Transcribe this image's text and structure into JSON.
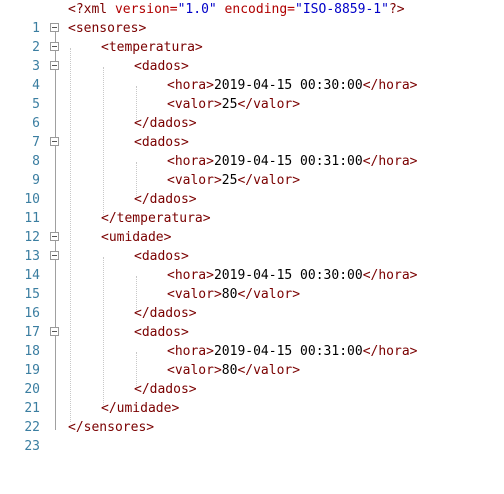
{
  "editor": {
    "lines": [
      {
        "n": "1"
      },
      {
        "n": "2"
      },
      {
        "n": "3"
      },
      {
        "n": "4"
      },
      {
        "n": "5"
      },
      {
        "n": "6"
      },
      {
        "n": "7"
      },
      {
        "n": "8"
      },
      {
        "n": "9"
      },
      {
        "n": "10"
      },
      {
        "n": "11"
      },
      {
        "n": "12"
      },
      {
        "n": "13"
      },
      {
        "n": "14"
      },
      {
        "n": "15"
      },
      {
        "n": "16"
      },
      {
        "n": "17"
      },
      {
        "n": "18"
      },
      {
        "n": "19"
      },
      {
        "n": "20"
      },
      {
        "n": "21"
      },
      {
        "n": "22"
      },
      {
        "n": "23"
      }
    ],
    "tokens": {
      "decl_open": "<?xml ",
      "decl_version_attr": "version=",
      "decl_version_val": "\"1.0\"",
      "decl_encoding_attr": " encoding=",
      "decl_encoding_val": "\"ISO-8859-1\"",
      "decl_close": "?>",
      "sensores_open": "<sensores>",
      "sensores_close": "</sensores>",
      "temperatura_open": "<temperatura>",
      "temperatura_close": "</temperatura>",
      "umidade_open": "<umidade>",
      "umidade_close": "</umidade>",
      "dados_open": "<dados>",
      "dados_close": "</dados>",
      "hora_open": "<hora>",
      "hora_close": "</hora>",
      "valor_open": "<valor>",
      "valor_close": "</valor>"
    },
    "values": {
      "t1_hora": "2019-04-15 00:30:00",
      "t1_valor": "25",
      "t2_hora": "2019-04-15 00:31:00",
      "t2_valor": "25",
      "u1_hora": "2019-04-15 00:30:00",
      "u1_valor": "80",
      "u2_hora": "2019-04-15 00:31:00",
      "u2_valor": "80"
    },
    "colors": {
      "tag": "#7a0000",
      "attribute": "#b00000",
      "string": "#0000c8",
      "line_number": "#3b7ea1"
    },
    "icons": {
      "fold": "fold-minus-icon"
    }
  }
}
